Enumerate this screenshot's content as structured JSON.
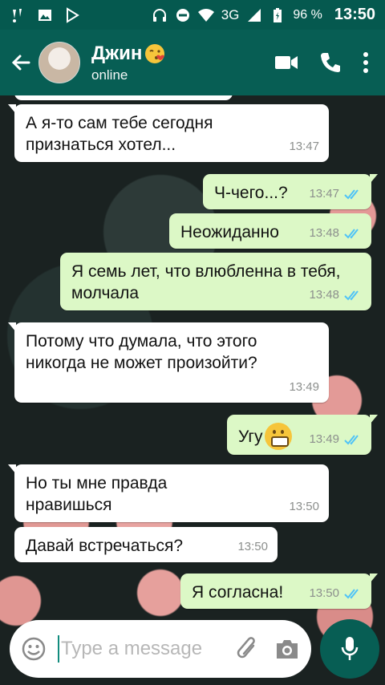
{
  "status_bar": {
    "battery": "96 %",
    "network": "3G",
    "time": "13:50"
  },
  "header": {
    "contact_name": "Джин",
    "contact_status": "online"
  },
  "messages": [
    {
      "dir": "in",
      "text": "А я-то сам тебе сегодня признаться хотел...",
      "time": "13:47"
    },
    {
      "dir": "out",
      "text": "Ч-чего...?",
      "time": "13:47"
    },
    {
      "dir": "out",
      "text": "Неожиданно",
      "time": "13:48"
    },
    {
      "dir": "out",
      "text": "Я семь лет, что влюбленна в тебя, молчала",
      "time": "13:48"
    },
    {
      "dir": "in",
      "text": "Потому что думала, что этого никогда не может произойти?",
      "time": "13:49"
    },
    {
      "dir": "out",
      "text": "Угу",
      "time": "13:49"
    },
    {
      "dir": "in",
      "text": "Но ты мне правда нравишься",
      "time": "13:50"
    },
    {
      "dir": "in",
      "text": "Давай встречаться?",
      "time": "13:50"
    },
    {
      "dir": "out",
      "text": "Я согласна!",
      "time": "13:50"
    }
  ],
  "composer": {
    "placeholder": "Type a message"
  },
  "colors": {
    "header": "#075e54",
    "status_bar": "#05594f",
    "outgoing_bubble": "#dcf8c6",
    "incoming_bubble": "#ffffff",
    "read_ticks": "#4fc3f7"
  }
}
